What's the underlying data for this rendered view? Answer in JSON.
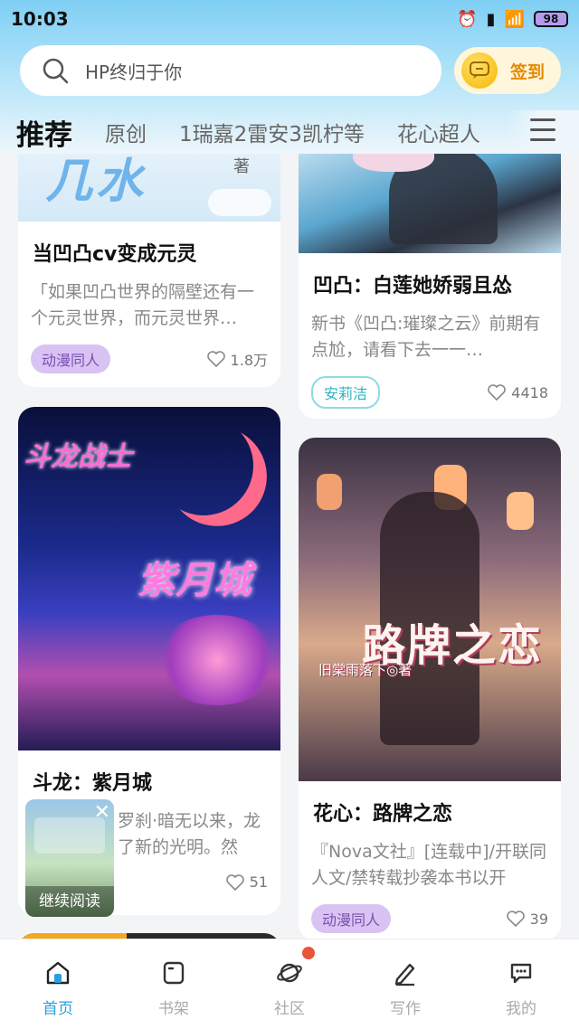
{
  "status_bar": {
    "time": "10:03",
    "battery": "98"
  },
  "search": {
    "placeholder": "HP终归于你"
  },
  "signin": {
    "label": "签到"
  },
  "tabs": [
    {
      "label": "推荐",
      "active": true
    },
    {
      "label": "原创"
    },
    {
      "label": "1瑞嘉2雷安3凯柠等"
    },
    {
      "label": "花心超人"
    }
  ],
  "cards": [
    {
      "cover_text": "著",
      "title": "当凹凸cv变成元灵",
      "desc": "「如果凹凸世界的隔壁还有一个元灵世界，而元灵世界…",
      "tag": "动漫同人",
      "likes": "1.8万"
    },
    {
      "title": "凹凸：白莲她娇弱且怂",
      "desc": "新书《凹凸:璀璨之云》前期有点尬，请看下去一一…",
      "tag": "安莉洁",
      "likes": "4418"
    },
    {
      "cover_text_1": "斗龙战士",
      "cover_text_2": "紫月城",
      "title": "斗龙：紫月城",
      "desc": "罗刹·暗无以来，龙了新的光明。然而…",
      "likes": "51"
    },
    {
      "cover_text": "路牌之恋",
      "cover_subtitle": "旧棠雨落下◎著",
      "title": "花心：路牌之恋",
      "desc": "『Nova文社』[连载中]/开联同人文/禁转载抄袭本书以开",
      "tag": "动漫同人",
      "likes": "39"
    }
  ],
  "continue_reading": {
    "label": "继续阅读"
  },
  "bottom_nav": [
    {
      "label": "首页",
      "icon": "home-icon",
      "active": true
    },
    {
      "label": "书架",
      "icon": "bookshelf-icon"
    },
    {
      "label": "社区",
      "icon": "planet-icon",
      "badge": true
    },
    {
      "label": "写作",
      "icon": "pen-icon"
    },
    {
      "label": "我的",
      "icon": "chat-icon"
    }
  ],
  "colors": {
    "accent": "#2a9fe0",
    "tag_purple": "#d9c3f2",
    "tag_cyan": "#2bb4c4",
    "badge": "#e8553a"
  }
}
